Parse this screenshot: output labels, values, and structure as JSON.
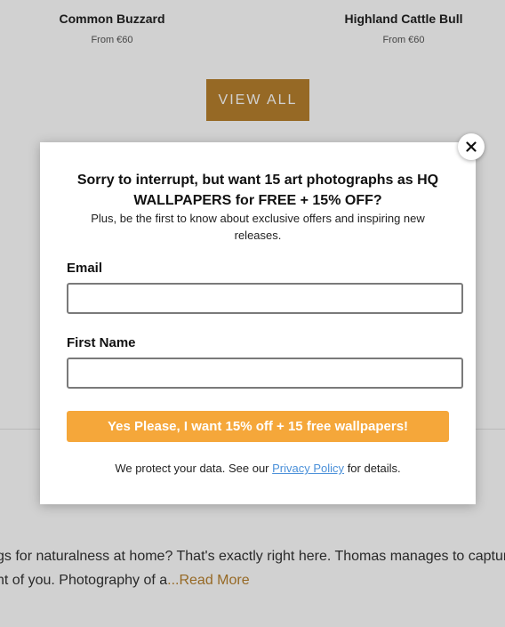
{
  "products": [
    {
      "name": "Common Buzzard",
      "price": "From €60"
    },
    {
      "name": "Highland Cattle Bull",
      "price": "From €60"
    }
  ],
  "view_all_label": "VIEW ALL",
  "about": {
    "heading_fragment": "!",
    "line1": "gs for naturalness at home? That's exactly right here. Thomas manages to captur",
    "line2": "nt of you. Photography of a",
    "read_more": "...Read More"
  },
  "popup": {
    "headline": "Sorry to interrupt, but want 15 art photographs as HQ WALLPAPERS for FREE + 15% OFF?",
    "subtext": "Plus, be the first to know about exclusive offers and inspiring new releases.",
    "email_label": "Email",
    "email_value": "",
    "first_name_label": "First Name",
    "first_name_value": "",
    "submit_label": "Yes Please, I want 15% off + 15 free wallpapers!",
    "privacy_prefix": "We protect your data. See our",
    "privacy_link": "Privacy Policy",
    "privacy_suffix": "for details.",
    "close_icon": "close-icon"
  },
  "colors": {
    "accent": "#b8812e",
    "submit": "#f5a73a",
    "link": "#4a90d9"
  }
}
